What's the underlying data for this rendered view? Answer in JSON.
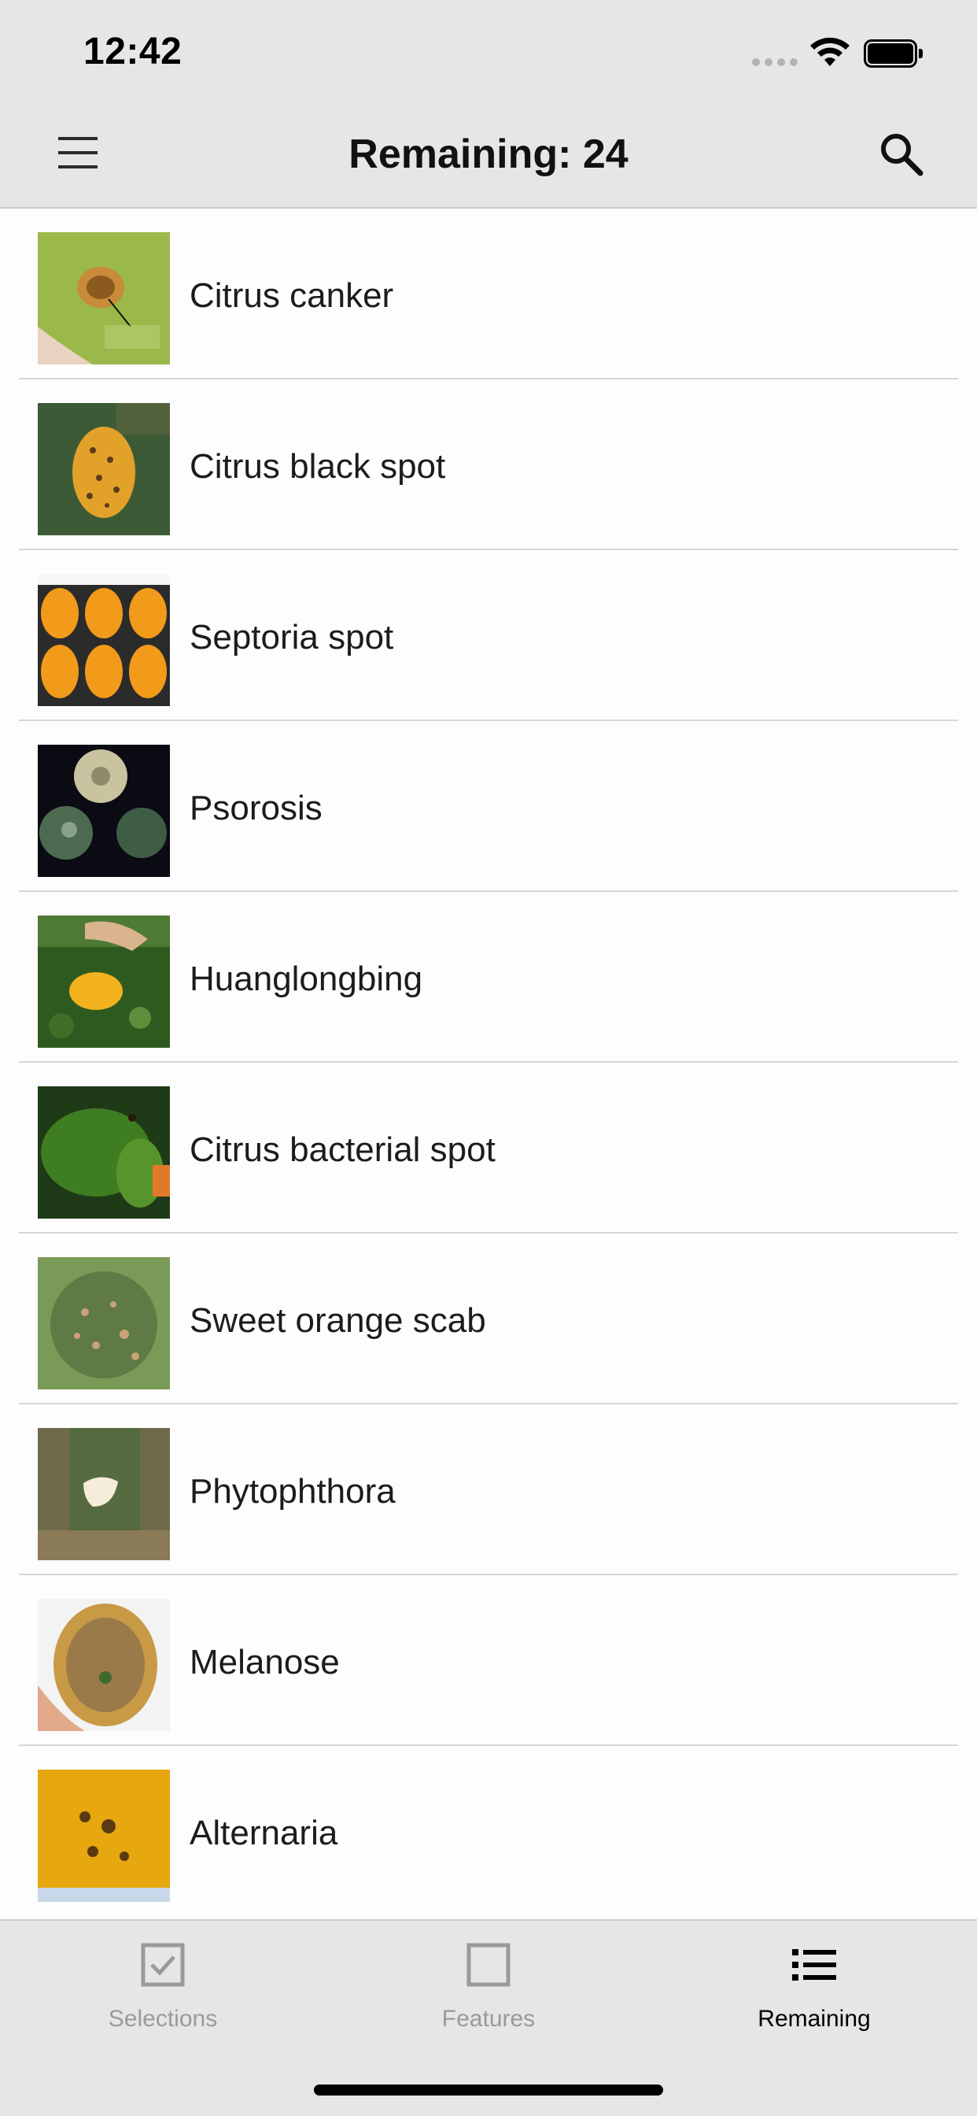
{
  "status_bar": {
    "time": "12:42"
  },
  "nav": {
    "title": "Remaining: 24"
  },
  "items": [
    {
      "label": "Citrus canker"
    },
    {
      "label": "Citrus black spot"
    },
    {
      "label": "Septoria spot"
    },
    {
      "label": "Psorosis"
    },
    {
      "label": "Huanglongbing"
    },
    {
      "label": "Citrus bacterial spot"
    },
    {
      "label": "Sweet orange scab"
    },
    {
      "label": "Phytophthora"
    },
    {
      "label": "Melanose"
    },
    {
      "label": "Alternaria"
    }
  ],
  "tabs": [
    {
      "label": "Selections",
      "icon": "checkbox-checked-icon",
      "active": false
    },
    {
      "label": "Features",
      "icon": "checkbox-empty-icon",
      "active": false
    },
    {
      "label": "Remaining",
      "icon": "list-icon",
      "active": true
    }
  ],
  "colors": {
    "bar_bg": "#e6e6e6",
    "inactive_tab": "#9a9a9a",
    "active_tab": "#000000"
  }
}
